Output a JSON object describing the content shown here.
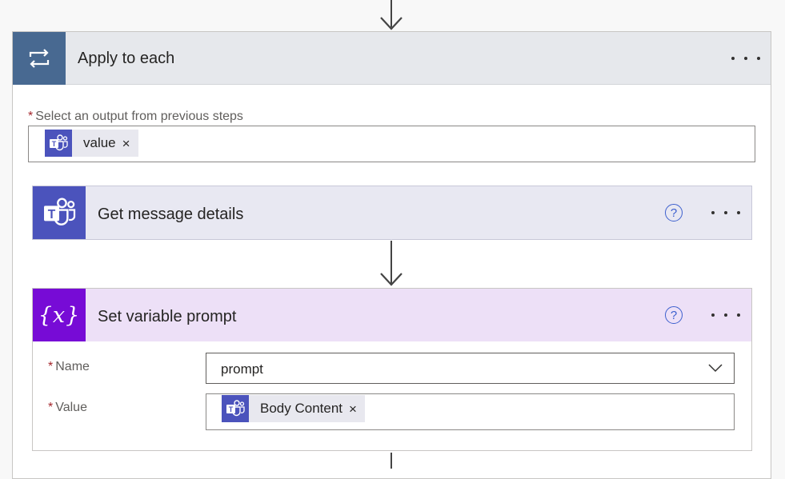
{
  "apply_to_each": {
    "title": "Apply to each",
    "icon": "loop-icon",
    "accent": "#486991",
    "output_field": {
      "label": "Select an output from previous steps",
      "required_mark": "*",
      "token": {
        "label": "value",
        "remove": "×",
        "icon": "teams-icon"
      }
    }
  },
  "get_message_details": {
    "title": "Get message details",
    "icon": "teams-icon",
    "accent": "#4b53bc",
    "help": "?"
  },
  "set_variable": {
    "title": "Set variable prompt",
    "icon": "variable-icon",
    "icon_text": "{x}",
    "accent": "#770bd6",
    "help": "?",
    "name_field": {
      "label": "Name",
      "required_mark": "*",
      "value": "prompt"
    },
    "value_field": {
      "label": "Value",
      "required_mark": "*",
      "token": {
        "label": "Body Content",
        "remove": "×",
        "icon": "teams-icon"
      }
    }
  }
}
